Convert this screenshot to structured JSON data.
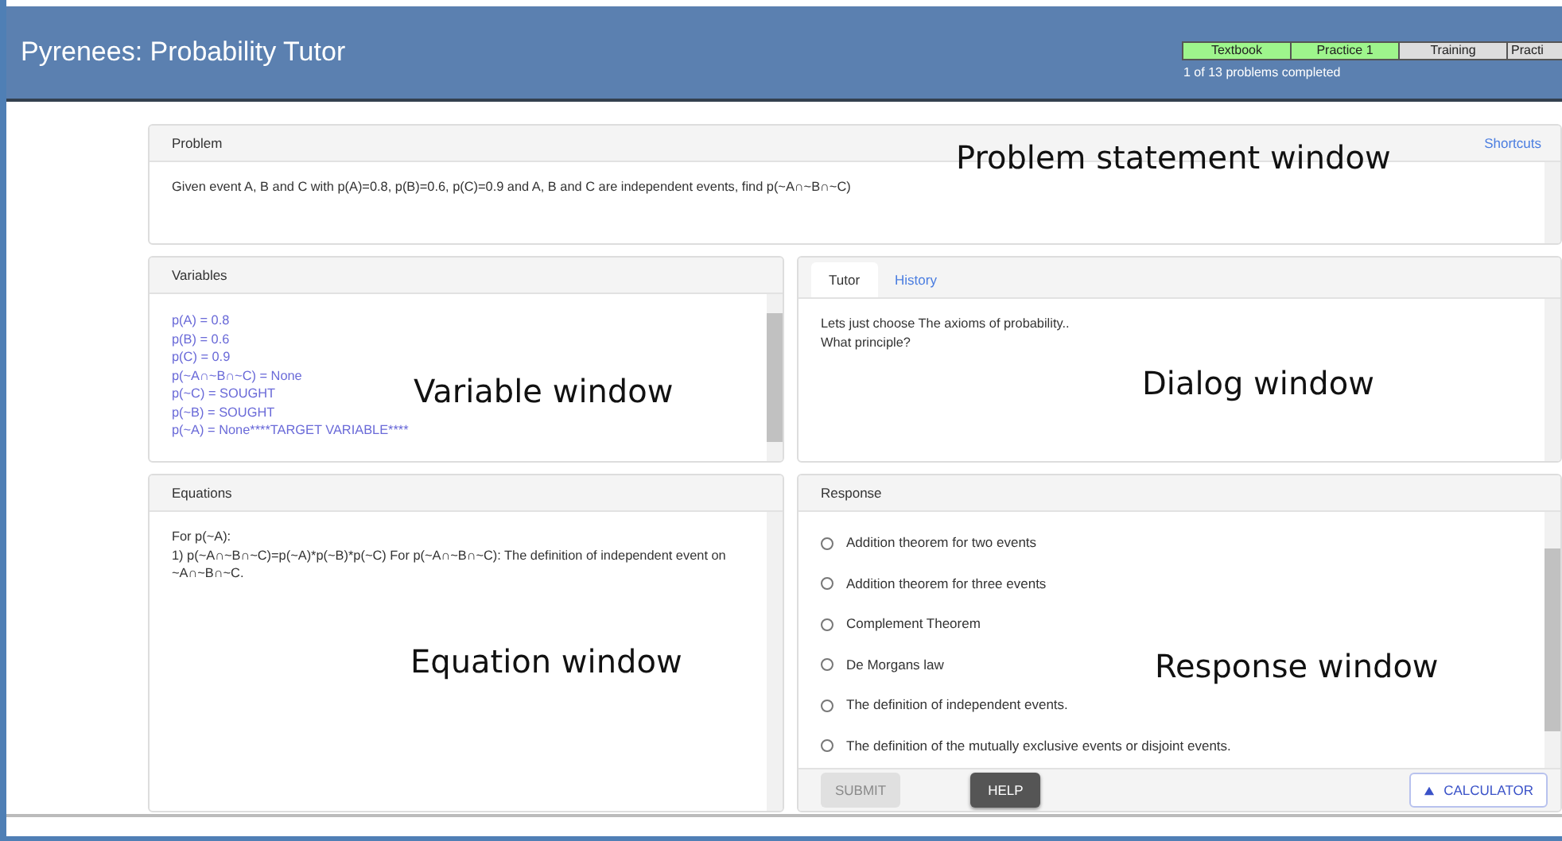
{
  "header": {
    "title": "Pyrenees: Probability Tutor",
    "progress_tabs": [
      {
        "label": "Textbook",
        "completed": true
      },
      {
        "label": "Practice 1",
        "completed": true
      },
      {
        "label": "Training",
        "completed": false
      },
      {
        "label": "Practi",
        "completed": false
      }
    ],
    "progress_text": "1 of 13 problems completed"
  },
  "problem": {
    "title": "Problem",
    "shortcuts_link": "Shortcuts",
    "text": "Given event A, B and C with p(A)=0.8, p(B)=0.6, p(C)=0.9 and A, B and C are independent events, find p(~A∩~B∩~C)"
  },
  "variables": {
    "title": "Variables",
    "lines": [
      "p(A) = 0.8",
      "p(B) = 0.6",
      "p(C) = 0.9",
      "p(~A∩~B∩~C) = None",
      "p(~C) = SOUGHT",
      "p(~B) = SOUGHT",
      "p(~A) = None****TARGET VARIABLE****"
    ]
  },
  "dialog": {
    "tabs": [
      {
        "label": "Tutor",
        "selected": true
      },
      {
        "label": "History",
        "selected": false
      }
    ],
    "lines": [
      "Lets just choose The axioms of probability..",
      "What principle?"
    ]
  },
  "equations": {
    "title": "Equations",
    "lines": [
      "For p(~A):",
      "1) p(~A∩~B∩~C)=p(~A)*p(~B)*p(~C) For p(~A∩~B∩~C): The definition of independent event on ~A∩~B∩~C."
    ]
  },
  "response": {
    "title": "Response",
    "options": [
      {
        "label": "Addition theorem for two events",
        "selected": false
      },
      {
        "label": "Addition theorem for three events",
        "selected": false
      },
      {
        "label": "Complement Theorem",
        "selected": false
      },
      {
        "label": "De Morgans law",
        "selected": false
      },
      {
        "label": "The definition of independent events.",
        "selected": false
      },
      {
        "label": "The definition of the mutually exclusive events or disjoint events.",
        "selected": false
      }
    ],
    "buttons": [
      {
        "label": "SUBMIT",
        "kind": "submit",
        "disabled": true
      },
      {
        "label": "HELP",
        "kind": "help",
        "disabled": false
      },
      {
        "label": "CALCULATOR",
        "kind": "calculator",
        "disabled": false
      }
    ]
  },
  "annotations": [
    "Problem statement window",
    "Variable window",
    "Dialog window",
    "Equation window",
    "Response window"
  ]
}
